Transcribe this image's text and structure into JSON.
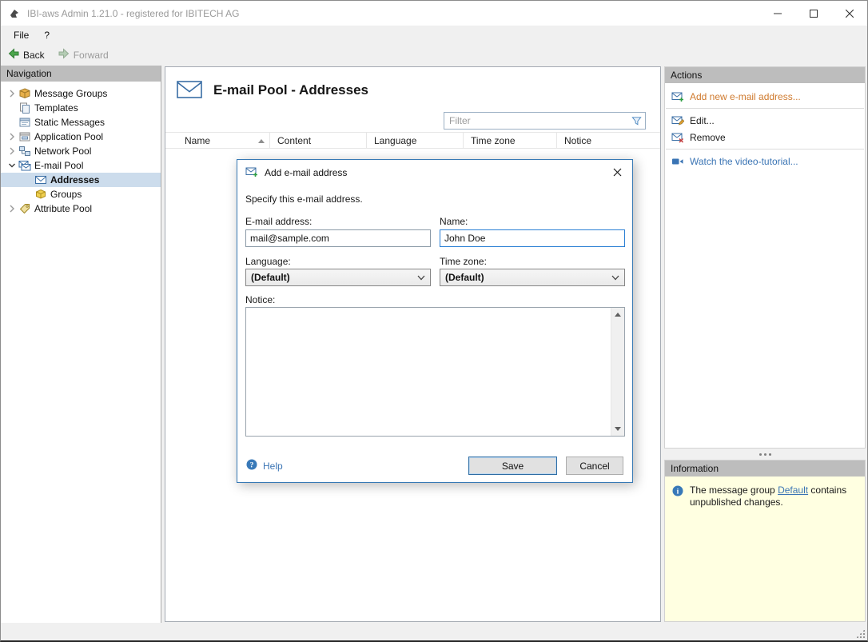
{
  "window": {
    "title": "IBI-aws Admin 1.21.0 - registered for IBITECH AG"
  },
  "menubar": {
    "file": "File",
    "help": "?"
  },
  "toolbar": {
    "back": "Back",
    "forward": "Forward"
  },
  "navigation": {
    "header": "Navigation",
    "items": [
      {
        "label": "Message Groups"
      },
      {
        "label": "Templates"
      },
      {
        "label": "Static Messages"
      },
      {
        "label": "Application Pool"
      },
      {
        "label": "Network Pool"
      },
      {
        "label": "E-mail Pool"
      },
      {
        "label": "Addresses"
      },
      {
        "label": "Groups"
      },
      {
        "label": "Attribute Pool"
      }
    ]
  },
  "main": {
    "title": "E-mail Pool - Addresses",
    "filter": {
      "placeholder": "Filter"
    },
    "table": {
      "columns": {
        "name": "Name",
        "content": "Content",
        "language": "Language",
        "timezone": "Time zone",
        "notice": "Notice"
      }
    }
  },
  "dialog": {
    "title": "Add e-mail address",
    "description": "Specify this e-mail address.",
    "email": {
      "label": "E-mail address:",
      "value": "mail@sample.com"
    },
    "name": {
      "label": "Name:",
      "value": "John Doe"
    },
    "language": {
      "label": "Language:",
      "value": "(Default)"
    },
    "timezone": {
      "label": "Time zone:",
      "value": "(Default)"
    },
    "notice": {
      "label": "Notice:"
    },
    "help": "Help",
    "save": "Save",
    "cancel": "Cancel"
  },
  "actions": {
    "header": "Actions",
    "add": "Add new e-mail address...",
    "edit": "Edit...",
    "remove": "Remove",
    "tutorial": "Watch the video-tutorial..."
  },
  "information": {
    "header": "Information",
    "text_before": "The message group ",
    "link": "Default",
    "text_after": " contains unpublished changes."
  },
  "icons": {
    "help_glyph": "?",
    "info_glyph": "i"
  },
  "colors": {
    "accent_blue": "#3779b5",
    "link_blue": "#3a74b4",
    "action_orange": "#cf7a2e",
    "info_yellow": "#ffffe1",
    "selection": "#ccdcec"
  }
}
